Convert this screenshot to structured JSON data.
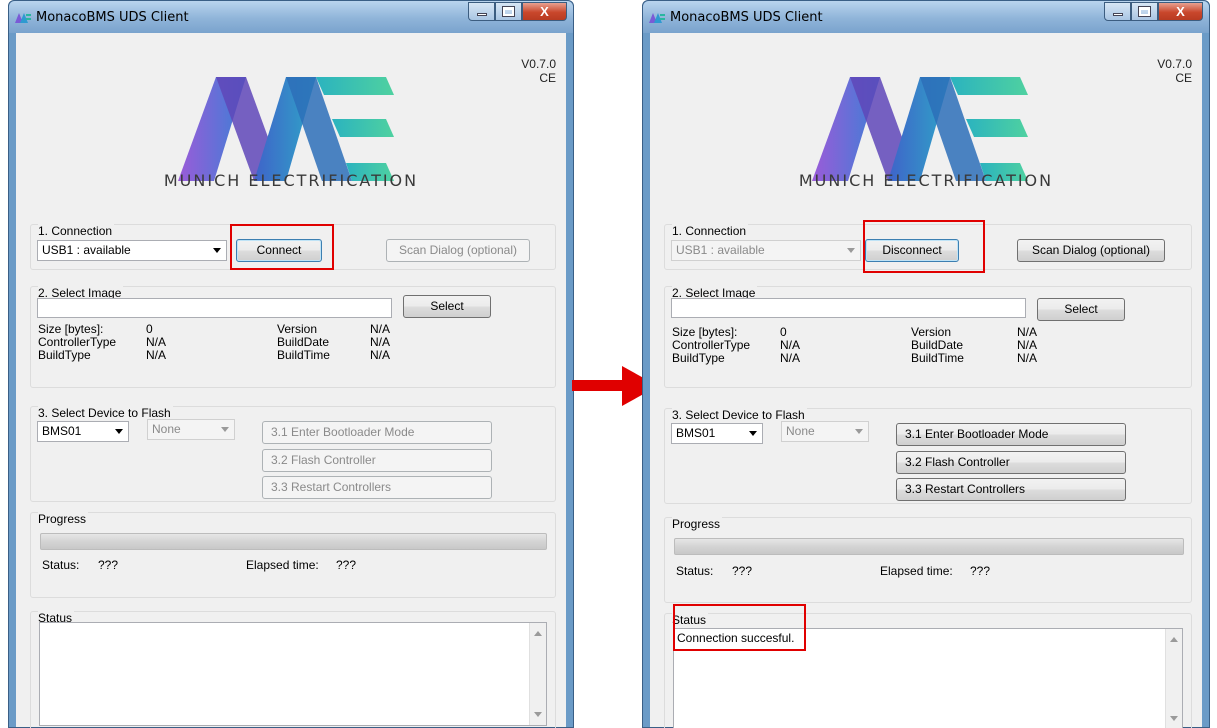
{
  "app": {
    "title": "MonacoBMS UDS Client",
    "version_line1": "V0.7.0",
    "version_line2": "CE",
    "brand": "MUNICH ELECTRIFICATION"
  },
  "title_buttons": {
    "close_glyph": "X"
  },
  "connection": {
    "section_label": "1. Connection",
    "port_value": "USB1 : available",
    "scan_label": "Scan Dialog (optional)"
  },
  "image": {
    "section_label": "2. Select Image",
    "path_value": "",
    "select_label": "Select",
    "fields": [
      {
        "label": "Size [bytes]:",
        "value": "0"
      },
      {
        "label": "ControllerType",
        "value": "N/A"
      },
      {
        "label": "BuildType",
        "value": "N/A"
      },
      {
        "label": "Version",
        "value": "N/A"
      },
      {
        "label": "BuildDate",
        "value": "N/A"
      },
      {
        "label": "BuildTime",
        "value": "N/A"
      }
    ]
  },
  "device": {
    "section_label": "3. Select Device to Flash",
    "device_value": "BMS01",
    "sub_value": "None",
    "enter_bootloader_label": "3.1 Enter Bootloader Mode",
    "flash_label": "3.2 Flash Controller",
    "restart_label": "3.3 Restart Controllers"
  },
  "progress": {
    "section_label": "Progress",
    "status_label": "Status:",
    "status_value": "???",
    "elapsed_label": "Elapsed time:",
    "elapsed_value": "???",
    "percent": 0
  },
  "status": {
    "section_label": "Status"
  },
  "windows": {
    "left": {
      "connect_label": "Connect",
      "status_log": ""
    },
    "right": {
      "connect_label": "Disconnect",
      "status_log": "Connection succesful."
    }
  },
  "colors": {
    "highlight": "#e00000",
    "arrow": "#e00000",
    "progress_fill": "#06b025"
  },
  "icons": {
    "arrow": "right-arrow-icon",
    "app_logo": "me-logo"
  }
}
